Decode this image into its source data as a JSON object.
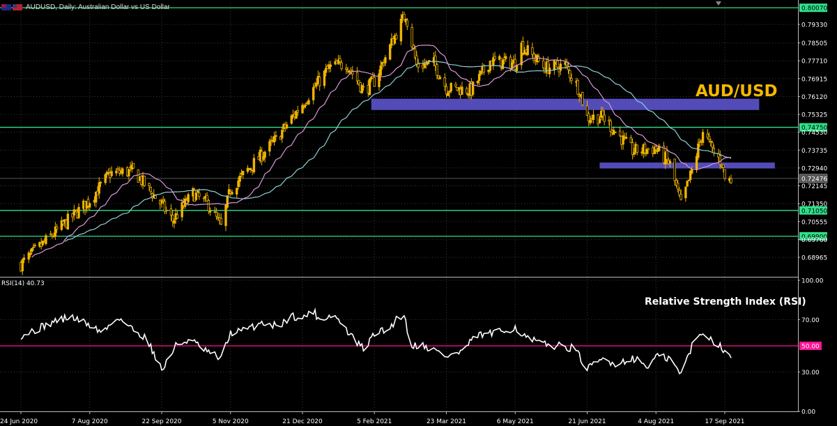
{
  "header": {
    "symbol": "AUDUSD",
    "timeframe": "Daily",
    "description": "Australian Dollar vs US Dollar",
    "title_text": "AUDUSD, Daily:  Australian Dollar vs US Dollar"
  },
  "overlay_titles": {
    "price": "AUD/USD",
    "rsi": "Relative Strength Index (RSI)"
  },
  "colors": {
    "background": "#000000",
    "candle": "#f0b400",
    "ma_fast": "#d89ad8",
    "ma_slow": "#8fd0d8",
    "level_line": "#2fe08a",
    "level_label_bg": "#2fe08a",
    "zone": "#5a52c8",
    "rsi_line": "#ffffff",
    "rsi_mid": "#ff1493",
    "grid": "#3a3a3a",
    "title": "#f5b800"
  },
  "chart_data": [
    {
      "type": "candlestick",
      "title": "AUD/USD",
      "symbol": "AUDUSD",
      "timeframe": "Daily",
      "y_ticks": [
        "0.79330",
        "0.78505",
        "0.77710",
        "0.76915",
        "0.76120",
        "0.75325",
        "0.74530",
        "0.73735",
        "0.72940",
        "0.72145",
        "0.71350",
        "0.70555",
        "0.69760",
        "0.68965"
      ],
      "y_tick_values": [
        0.7933,
        0.78505,
        0.7771,
        0.76915,
        0.7612,
        0.75325,
        0.7453,
        0.73735,
        0.7294,
        0.72145,
        0.7135,
        0.70555,
        0.6976,
        0.68965
      ],
      "ylim": [
        0.6852,
        0.8028
      ],
      "x_labels": [
        "24 Jun 2020",
        "7 Aug 2020",
        "22 Sep 2020",
        "5 Nov 2020",
        "21 Dec 2020",
        "5 Feb 2021",
        "23 Mar 2021",
        "6 May 2021",
        "21 Jun 2021",
        "4 Aug 2021",
        "17 Sep 2021"
      ],
      "horizontal_levels": [
        {
          "label": "0.80070",
          "value": 0.8007
        },
        {
          "label": "0.74750",
          "value": 0.7475
        },
        {
          "label": "0.71050",
          "value": 0.7105
        },
        {
          "label": "0.69900",
          "value": 0.699
        }
      ],
      "current_price": {
        "label": "0.72476",
        "value": 0.72476
      },
      "zones": [
        {
          "from_date": "3 Feb 2021",
          "to_date": "9 Oct 2021",
          "low": 0.7552,
          "high": 0.7602
        },
        {
          "from_date": "29 Jun 2021",
          "to_date": "19 Oct 2021",
          "low": 0.7292,
          "high": 0.7318
        }
      ],
      "close_anchors": [
        [
          "24 Jun 2020",
          0.6865
        ],
        [
          "7 Aug 2020",
          0.715
        ],
        [
          "20 Aug 2020",
          0.727
        ],
        [
          "4 Sep 2020",
          0.728
        ],
        [
          "22 Sep 2020",
          0.713
        ],
        [
          "29 Sep 2020",
          0.706
        ],
        [
          "12 Oct 2020",
          0.718
        ],
        [
          "22 Oct 2020",
          0.713
        ],
        [
          "30 Oct 2020",
          0.703
        ],
        [
          "5 Nov 2020",
          0.72
        ],
        [
          "18 Nov 2020",
          0.73
        ],
        [
          "4 Dec 2020",
          0.742
        ],
        [
          "21 Dec 2020",
          0.758
        ],
        [
          "7 Jan 2021",
          0.774
        ],
        [
          "18 Jan 2021",
          0.776
        ],
        [
          "29 Jan 2021",
          0.764
        ],
        [
          "5 Feb 2021",
          0.768
        ],
        [
          "18 Feb 2021",
          0.788
        ],
        [
          "25 Feb 2021",
          0.798
        ],
        [
          "4 Mar 2021",
          0.775
        ],
        [
          "15 Mar 2021",
          0.776
        ],
        [
          "23 Mar 2021",
          0.765
        ],
        [
          "8 Apr 2021",
          0.764
        ],
        [
          "20 Apr 2021",
          0.777
        ],
        [
          "6 May 2021",
          0.776
        ],
        [
          "10 May 2021",
          0.784
        ],
        [
          "25 May 2021",
          0.774
        ],
        [
          "7 Jun 2021",
          0.775
        ],
        [
          "16 Jun 2021",
          0.764
        ],
        [
          "21 Jun 2021",
          0.752
        ],
        [
          "1 Jul 2021",
          0.752
        ],
        [
          "20 Jul 2021",
          0.737
        ],
        [
          "4 Aug 2021",
          0.738
        ],
        [
          "13 Aug 2021",
          0.731
        ],
        [
          "20 Aug 2021",
          0.713
        ],
        [
          "27 Aug 2021",
          0.728
        ],
        [
          "3 Sep 2021",
          0.746
        ],
        [
          "10 Sep 2021",
          0.736
        ],
        [
          "15 Sep 2021",
          0.732
        ],
        [
          "17 Sep 2021",
          0.7248
        ],
        [
          "21 Sep 2021",
          0.724
        ]
      ],
      "moving_averages": [
        {
          "name": "fast",
          "color_key": "ma_fast"
        },
        {
          "name": "slow",
          "color_key": "ma_slow"
        }
      ]
    },
    {
      "type": "line",
      "title": "Relative Strength Index (RSI)",
      "indicator_label": "RSI(14) 40.73",
      "y_ticks": [
        "100.00",
        "70.00",
        "50.00",
        "30.00",
        "0.00"
      ],
      "y_tick_values": [
        100,
        70,
        50,
        30,
        0
      ],
      "ylim": [
        0,
        100
      ],
      "level": {
        "label": "50.00",
        "value": 50
      },
      "last_value": 40.73,
      "anchors": [
        [
          "24 Jun 2020",
          58
        ],
        [
          "5 Jul 2020",
          63
        ],
        [
          "16 Jul 2020",
          69
        ],
        [
          "26 Jul 2020",
          72
        ],
        [
          "7 Aug 2020",
          66
        ],
        [
          "15 Aug 2020",
          60
        ],
        [
          "25 Aug 2020",
          72
        ],
        [
          "4 Sep 2020",
          62
        ],
        [
          "12 Sep 2020",
          56
        ],
        [
          "19 Sep 2020",
          40
        ],
        [
          "22 Sep 2020",
          31
        ],
        [
          "1 Oct 2020",
          50
        ],
        [
          "10 Oct 2020",
          55
        ],
        [
          "20 Oct 2020",
          46
        ],
        [
          "30 Oct 2020",
          40
        ],
        [
          "5 Nov 2020",
          60
        ],
        [
          "15 Nov 2020",
          62
        ],
        [
          "25 Nov 2020",
          68
        ],
        [
          "5 Dec 2020",
          65
        ],
        [
          "15 Dec 2020",
          73
        ],
        [
          "21 Dec 2020",
          70
        ],
        [
          "27 Dec 2020",
          78
        ],
        [
          "1 Jan 2021",
          70
        ],
        [
          "10 Jan 2021",
          74
        ],
        [
          "18 Jan 2021",
          62
        ],
        [
          "25 Jan 2021",
          52
        ],
        [
          "30 Jan 2021",
          47
        ],
        [
          "5 Feb 2021",
          60
        ],
        [
          "14 Feb 2021",
          62
        ],
        [
          "20 Feb 2021",
          72
        ],
        [
          "24 Feb 2021",
          74
        ],
        [
          "28 Feb 2021",
          50
        ],
        [
          "6 Mar 2021",
          51
        ],
        [
          "15 Mar 2021",
          47
        ],
        [
          "23 Mar 2021",
          42
        ],
        [
          "1 Apr 2021",
          45
        ],
        [
          "12 Apr 2021",
          58
        ],
        [
          "25 Apr 2021",
          60
        ],
        [
          "6 May 2021",
          64
        ],
        [
          "13 May 2021",
          56
        ],
        [
          "24 May 2021",
          51
        ],
        [
          "3 Jun 2021",
          50
        ],
        [
          "13 Jun 2021",
          48
        ],
        [
          "21 Jun 2021",
          32
        ],
        [
          "1 Jul 2021",
          40
        ],
        [
          "10 Jul 2021",
          36
        ],
        [
          "20 Jul 2021",
          41
        ],
        [
          "30 Jul 2021",
          34
        ],
        [
          "4 Aug 2021",
          42
        ],
        [
          "13 Aug 2021",
          40
        ],
        [
          "20 Aug 2021",
          28
        ],
        [
          "27 Aug 2021",
          50
        ],
        [
          "3 Sep 2021",
          61
        ],
        [
          "8 Sep 2021",
          55
        ],
        [
          "14 Sep 2021",
          51
        ],
        [
          "17 Sep 2021",
          44
        ],
        [
          "21 Sep 2021",
          40.73
        ]
      ]
    }
  ]
}
